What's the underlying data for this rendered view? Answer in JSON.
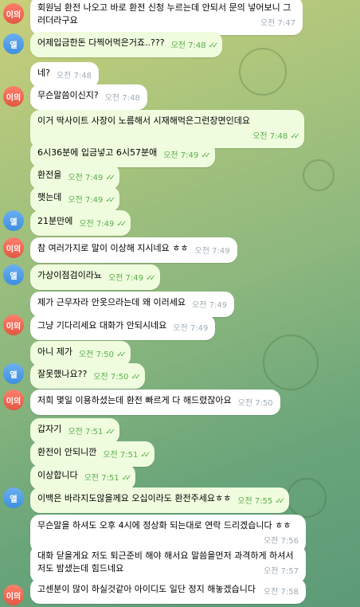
{
  "chat": {
    "avatars": {
      "other": {
        "label": "이의",
        "color": "#e25843"
      },
      "me": {
        "label": "앨",
        "color": "#3e8fe0"
      }
    },
    "messages": [
      {
        "text": "회원님 환전 나오고 바로 환전 신청 누르는데 안되서 문의 넣어보니 그러더라구요",
        "time": "오전 7:47",
        "side": "in"
      },
      {
        "text": "어제입금한돈 다찍어먹은거죠..???",
        "time": "오전 7:48",
        "side": "out"
      },
      {
        "text": "네?",
        "time": "오전 7:48",
        "side": "in"
      },
      {
        "text": "무슨말씀이신지?",
        "time": "오전 7:48",
        "side": "in"
      },
      {
        "text": "이거 딱사이트 사장이 노름해서 시재해먹은그런장면인데요",
        "time": "오전 7:48",
        "side": "out"
      },
      {
        "text": "6시36분에 입금넣고 6시57분애",
        "time": "오전 7:49",
        "side": "out"
      },
      {
        "text": "환전을",
        "time": "오전 7:49",
        "side": "out"
      },
      {
        "text": "햇는데",
        "time": "오전 7:49",
        "side": "out"
      },
      {
        "text": "21분만에",
        "time": "오전 7:49",
        "side": "out"
      },
      {
        "text": "참 여러가지로 말이 이상해 지시네요 ㅎㅎ",
        "time": "오전 7:49",
        "side": "in"
      },
      {
        "text": "가상이점검이라뇨",
        "time": "오전 7:49",
        "side": "out"
      },
      {
        "text": "제가 근무자라 안옷으라는데 왜 이러세요",
        "time": "오전 7:49",
        "side": "in"
      },
      {
        "text": "그냥 기다리세요 대화가 안되시네요",
        "time": "오전 7:49",
        "side": "in"
      },
      {
        "text": "아니 제가",
        "time": "오전 7:50",
        "side": "out"
      },
      {
        "text": "잘못했나요??",
        "time": "오전 7:50",
        "side": "out"
      },
      {
        "text": "저희 몇일 이용하셨는데 환전 빠르게 다 해드렸잖아요",
        "time": "오전 7:50",
        "side": "in"
      },
      {
        "text": "갑자기",
        "time": "오전 7:51",
        "side": "out"
      },
      {
        "text": "환전이 안되니깐",
        "time": "오전 7:51",
        "side": "out"
      },
      {
        "text": "이상합니다",
        "time": "오전 7:51",
        "side": "out"
      },
      {
        "text": "이백은 바라지도않을께요 오십이라도 환전주세요ㅎㅎ",
        "time": "오전 7:55",
        "side": "out"
      },
      {
        "text": "무슨말을 하셔도 오후 4시에 정상화 되는대로 연락 드리겠습니다 ㅎㅎ",
        "time": "오전 7:56",
        "side": "in"
      },
      {
        "text": "대화 닫을게요 저도 퇴근준비 해야 해서요 말씀을먼저 과격하게 하셔서 저도 밤샜는데 힘드네요",
        "time": "오전 7:57",
        "side": "in"
      },
      {
        "text": "고센분이 많이 하실것같아 아이디도 일단 정지 해놓겠습니다",
        "time": "오전 7:58",
        "side": "in"
      }
    ]
  }
}
